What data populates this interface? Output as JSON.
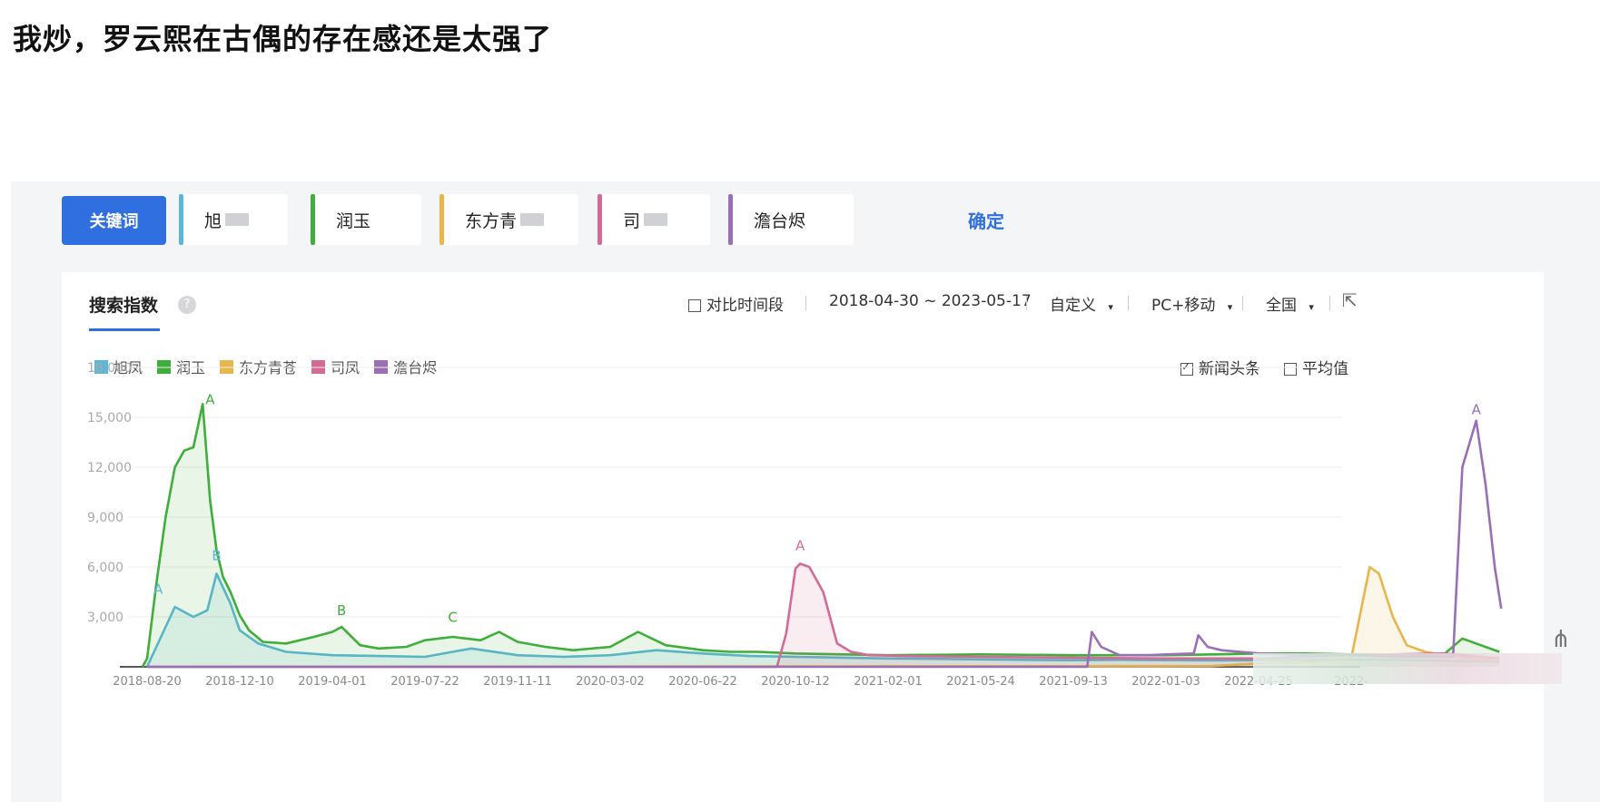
{
  "post": {
    "title": "我炒，罗云熙在古偶的存在感还是太强了"
  },
  "keywords": {
    "button_label": "关键词",
    "items": [
      {
        "text": "旭",
        "color": "#5ab7d8",
        "blurred": true
      },
      {
        "text": "润玉",
        "color": "#3fae3b",
        "blurred": false
      },
      {
        "text": "东方青",
        "color": "#e8b64a",
        "blurred": true
      },
      {
        "text": "司",
        "color": "#d46a96",
        "blurred": true
      },
      {
        "text": "澹台烬",
        "color": "#9b6fb5",
        "blurred": false
      }
    ],
    "confirm_label": "确定"
  },
  "toolbar": {
    "tab_title": "搜索指数",
    "help_icon": "?",
    "compare_label": "对比时间段",
    "date_range": "2018-04-30 ~ 2023-05-17",
    "custom_label": "自定义",
    "device_label": "PC+移动",
    "region_label": "全国",
    "dropdown_icon": "▾",
    "export_icon": "external-link-icon"
  },
  "options": {
    "news_label": "新闻头条",
    "news_checked": true,
    "avg_label": "平均值",
    "avg_checked": false
  },
  "chart_data": {
    "type": "line",
    "title": "搜索指数",
    "legend": [
      "旭凤",
      "润玉",
      "东方青苍",
      "司凤",
      "澹台烬"
    ],
    "ylim": [
      0,
      18000
    ],
    "y_ticks": [
      3000,
      6000,
      9000,
      12000,
      15000,
      18000
    ],
    "y_tick_labels": [
      "3,000",
      "6,000",
      "9,000",
      "12,000",
      "15,000",
      "18,000"
    ],
    "x_ticks": [
      "2018-08-20",
      "2018-12-10",
      "2019-04-01",
      "2019-07-22",
      "2019-11-11",
      "2020-03-02",
      "2020-06-22",
      "2020-10-12",
      "2021-02-01",
      "2021-05-24",
      "2021-09-13",
      "2022-01-03",
      "2022-04-25",
      "2022-"
    ],
    "series": [
      {
        "name": "旭凤",
        "color": "#5ab7d8",
        "fill": true,
        "x": [
          0,
          0.3,
          0.5,
          0.65,
          0.75,
          0.9,
          1.0,
          1.2,
          1.5,
          2,
          2.5,
          3,
          3.5,
          4,
          4.5,
          5,
          5.5,
          6,
          6.5,
          7,
          7.5,
          8,
          8.5,
          9,
          9.5,
          10,
          10.5,
          11,
          11.5,
          12,
          12.5,
          13,
          13.5,
          14.6
        ],
        "y": [
          0,
          3600,
          3000,
          3400,
          5600,
          3800,
          2200,
          1400,
          900,
          700,
          650,
          600,
          1100,
          700,
          600,
          700,
          1000,
          800,
          650,
          600,
          550,
          500,
          480,
          450,
          420,
          400,
          420,
          400,
          380,
          400,
          420,
          430,
          420,
          300
        ]
      },
      {
        "name": "润玉",
        "color": "#3fae3b",
        "fill": true,
        "x": [
          -0.05,
          0,
          0.1,
          0.2,
          0.3,
          0.4,
          0.5,
          0.6,
          0.68,
          0.75,
          0.82,
          0.9,
          1.0,
          1.1,
          1.25,
          1.5,
          1.8,
          2,
          2.1,
          2.3,
          2.5,
          2.8,
          3,
          3.3,
          3.6,
          3.8,
          4,
          4.3,
          4.6,
          5,
          5.3,
          5.6,
          6,
          6.3,
          6.6,
          7,
          8,
          9,
          10,
          11,
          11.5,
          12,
          12.5,
          13,
          13.5,
          14,
          14.2,
          14.4,
          14.6
        ],
        "y": [
          0,
          500,
          5000,
          9000,
          12000,
          13000,
          13200,
          15800,
          10000,
          7000,
          5400,
          4500,
          3100,
          2200,
          1500,
          1400,
          1800,
          2100,
          2400,
          1300,
          1100,
          1200,
          1600,
          1800,
          1600,
          2100,
          1500,
          1200,
          1000,
          1200,
          2100,
          1300,
          1000,
          900,
          900,
          800,
          700,
          750,
          700,
          700,
          750,
          800,
          800,
          750,
          700,
          750,
          1700,
          1300,
          900
        ]
      },
      {
        "name": "东方青苍",
        "color": "#e8b64a",
        "fill": true,
        "x": [
          0,
          11.5,
          12,
          12.6,
          13.0,
          13.2,
          13.3,
          13.45,
          13.6,
          13.8,
          14.0,
          14.3,
          14.6
        ],
        "y": [
          0,
          50,
          200,
          300,
          500,
          6000,
          5600,
          3000,
          1300,
          900,
          700,
          500,
          400
        ]
      },
      {
        "name": "司凤",
        "color": "#d46a96",
        "fill": true,
        "x": [
          0,
          6.8,
          6.9,
          7.0,
          7.05,
          7.15,
          7.3,
          7.45,
          7.6,
          7.8,
          8.2,
          9,
          10,
          11,
          12,
          13,
          14,
          14.6
        ],
        "y": [
          0,
          0,
          2000,
          5900,
          6200,
          6000,
          4500,
          1400,
          900,
          700,
          650,
          600,
          550,
          500,
          500,
          700,
          800,
          500
        ]
      },
      {
        "name": "澹台烬",
        "color": "#9b6fb5",
        "fill": false,
        "x": [
          0,
          10.0,
          10.15,
          10.2,
          10.3,
          10.5,
          10.8,
          11.0,
          11.3,
          11.35,
          11.45,
          11.6,
          12,
          12.5,
          13,
          13.5,
          14,
          14.1,
          14.2,
          14.35,
          14.45,
          14.55,
          14.62
        ],
        "y": [
          0,
          0,
          0,
          2100,
          1200,
          700,
          700,
          750,
          800,
          1900,
          1200,
          1000,
          800,
          700,
          700,
          600,
          600,
          600,
          12000,
          14800,
          11000,
          6000,
          3500
        ]
      }
    ],
    "annotations": [
      {
        "label": "A",
        "series": "润玉",
        "x": 0.68,
        "y": 15800
      },
      {
        "label": "A",
        "series": "旭凤",
        "x": 0.12,
        "y": 4400
      },
      {
        "label": "B",
        "series": "旭凤",
        "x": 0.75,
        "y": 6400
      },
      {
        "label": "B",
        "series": "润玉",
        "x": 2.1,
        "y": 3100
      },
      {
        "label": "C",
        "series": "润玉",
        "x": 3.3,
        "y": 2700
      },
      {
        "label": "A",
        "series": "司凤",
        "x": 7.05,
        "y": 7000
      },
      {
        "label": "A",
        "series": "澹台烬",
        "x": 14.35,
        "y": 15200
      }
    ]
  }
}
